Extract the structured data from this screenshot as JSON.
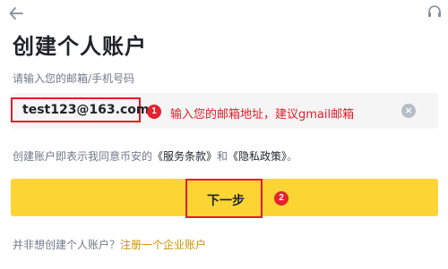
{
  "header": {
    "back_icon": "arrow-left-icon",
    "support_icon": "headset-icon"
  },
  "title": "创建个人账户",
  "email_field": {
    "label": "请输入您的邮箱/手机号码",
    "value": "test123@163.com",
    "clear_icon": "clear-icon"
  },
  "annotations": {
    "step1_number": "1",
    "step1_text": "输入您的邮箱地址，建议gmail邮箱",
    "step2_number": "2",
    "highlight_color": "#e11d2a"
  },
  "terms": {
    "prefix": "创建账户即表示我同意币安的",
    "service_terms": "《服务条款》",
    "conjunction": "和",
    "privacy_policy": "《隐私政策》",
    "suffix": "。"
  },
  "next_button": {
    "label": "下一步",
    "color": "#fcd535"
  },
  "footer": {
    "question": "并非想创建个人账户？",
    "link": "注册一个企业账户",
    "link_color": "#c99400"
  }
}
